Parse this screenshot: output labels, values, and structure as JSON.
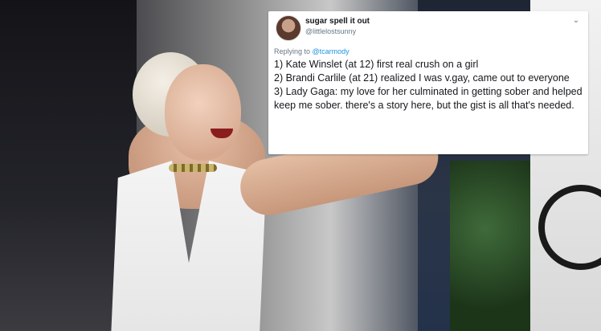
{
  "tweet": {
    "display_name": "sugar spell it out",
    "handle": "@littlelostsunny",
    "replying_to_prefix": "Replying to ",
    "replying_to_handle": "@tcarmody",
    "lines": [
      "1) Kate Winslet (at 12) first real crush on a girl",
      "2) Brandi Carlile (at 21) realized I was v.gay, came out to everyone",
      "3) Lady Gaga:  my love for her culminated in getting sober and helped keep me sober.  there's a story here, but the gist is all that's needed."
    ],
    "menu_icon": "chevron-down-icon"
  }
}
